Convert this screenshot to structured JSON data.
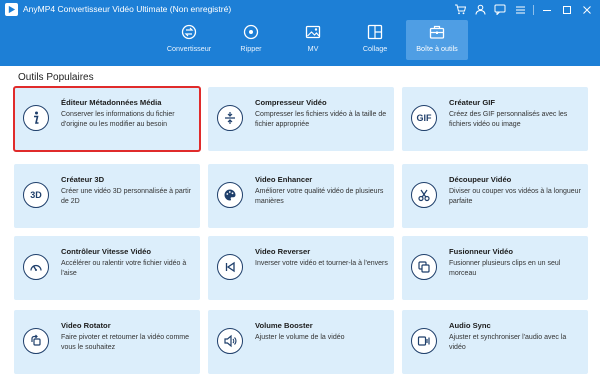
{
  "app": {
    "title": "AnyMP4 Convertisseur Vidéo Ultimate (Non enregistré)"
  },
  "nav": {
    "tabs": [
      {
        "label": "Convertisseur",
        "icon": "convert-icon",
        "active": false
      },
      {
        "label": "Ripper",
        "icon": "disc-icon",
        "active": false
      },
      {
        "label": "MV",
        "icon": "image-icon",
        "active": false
      },
      {
        "label": "Collage",
        "icon": "collage-icon",
        "active": false
      },
      {
        "label": "Boîte à outils",
        "icon": "toolbox-icon",
        "active": true
      }
    ]
  },
  "section": {
    "title": "Outils Populaires"
  },
  "tools": [
    {
      "name": "Éditeur Métadonnées Média",
      "desc": "Conserver les informations du fichier d'origine ou les modifier au besoin",
      "icon": "info-icon",
      "selected": true
    },
    {
      "name": "Compresseur Vidéo",
      "desc": "Compresser les fichiers vidéo à la taille de fichier appropriée",
      "icon": "compress-icon",
      "selected": false
    },
    {
      "name": "Créateur GIF",
      "desc": "Créez des GIF personnalisés avec les fichiers vidéo ou image",
      "icon": "gif-icon",
      "icon_text": "GIF",
      "selected": false
    },
    {
      "name": "Créateur 3D",
      "desc": "Créer une vidéo 3D personnalisée à partir de 2D",
      "icon": "3d-icon",
      "icon_text": "3D",
      "selected": false
    },
    {
      "name": "Video Enhancer",
      "desc": "Améliorer votre qualité vidéo de plusieurs manières",
      "icon": "palette-icon",
      "selected": false
    },
    {
      "name": "Découpeur Vidéo",
      "desc": "Diviser ou couper vos vidéos à la longueur parfaite",
      "icon": "scissors-icon",
      "selected": false
    },
    {
      "name": "Contrôleur Vitesse Vidéo",
      "desc": "Accélérer ou ralentir votre fichier vidéo à l'aise",
      "icon": "speedometer-icon",
      "selected": false
    },
    {
      "name": "Video Reverser",
      "desc": "Inverser votre vidéo et tourner-la à l'envers",
      "icon": "rewind-icon",
      "selected": false
    },
    {
      "name": "Fusionneur Vidéo",
      "desc": "Fusionner plusieurs clips en un seul morceau",
      "icon": "merge-icon",
      "selected": false
    },
    {
      "name": "Video Rotator",
      "desc": "Faire pivoter et retourner la vidéo comme vous le souhaitez",
      "icon": "rotate-icon",
      "selected": false
    },
    {
      "name": "Volume Booster",
      "desc": "Ajuster le volume de la vidéo",
      "icon": "volume-icon",
      "selected": false
    },
    {
      "name": "Audio Sync",
      "desc": "Ajuster et synchroniser l'audio avec la vidéo",
      "icon": "audio-sync-icon",
      "selected": false
    }
  ],
  "colors": {
    "header": "#1d7fd6",
    "active_tab": "#4f9ee4",
    "card_bg": "#dceefb",
    "selection": "#e02b2b",
    "icon_stroke": "#1f3f6b"
  }
}
